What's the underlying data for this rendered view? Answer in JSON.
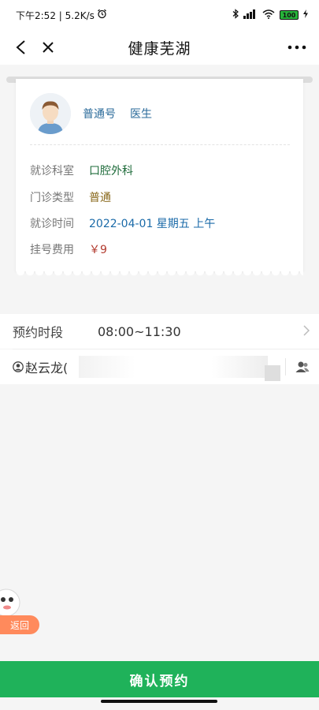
{
  "status_bar": {
    "time_speed": "下午2:52 | 5.2K/s",
    "battery": "100"
  },
  "nav": {
    "title": "健康芜湖"
  },
  "ticket": {
    "doctor_type": "普通号",
    "doctor_title": "医生",
    "rows": [
      {
        "label": "就诊科室",
        "value": "口腔外科"
      },
      {
        "label": "门诊类型",
        "value": "普通"
      },
      {
        "label": "就诊时间",
        "value": "2022-04-01 星期五 上午"
      },
      {
        "label": "挂号费用",
        "value": "￥9"
      }
    ]
  },
  "period": {
    "label": "预约时段",
    "value": "08:00~11:30"
  },
  "patient": {
    "name": "赵云龙("
  },
  "float": {
    "return_label": "返回"
  },
  "footer": {
    "confirm_label": "确认预约"
  },
  "colors": {
    "accent_green": "#1fb25a",
    "return_orange": "#ff8a5c",
    "link_blue": "#2a6a9a",
    "fee_red": "#b23a2e"
  }
}
